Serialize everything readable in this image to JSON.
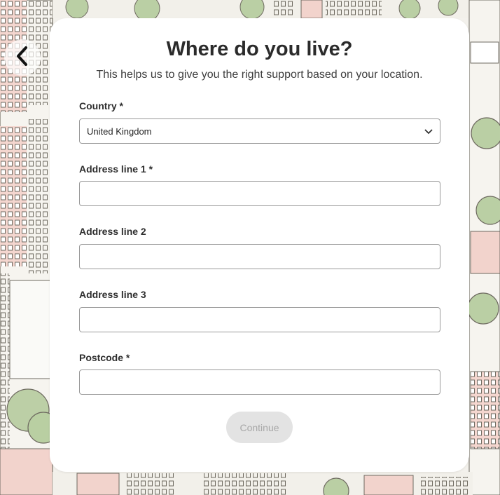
{
  "page": {
    "title": "Where do you live?",
    "subtitle": "This helps us to give you the right support based on your location."
  },
  "form": {
    "country_label": "Country *",
    "country_value": "United Kingdom",
    "address1_label": "Address line 1 *",
    "address1_value": "",
    "address2_label": "Address line 2",
    "address2_value": "",
    "address3_label": "Address line 3",
    "address3_value": "",
    "postcode_label": "Postcode *",
    "postcode_value": "",
    "continue_label": "Continue"
  },
  "icons": {
    "back": "chevron-left-icon",
    "dropdown": "chevron-down-icon"
  },
  "colors": {
    "card_bg": "#ffffff",
    "text": "#2b2b2b",
    "disabled_button_bg": "#e3e3e3",
    "disabled_button_text": "#a8a8a8",
    "bg_pink": "#f2d3cc",
    "bg_green": "#b9cfa2"
  }
}
